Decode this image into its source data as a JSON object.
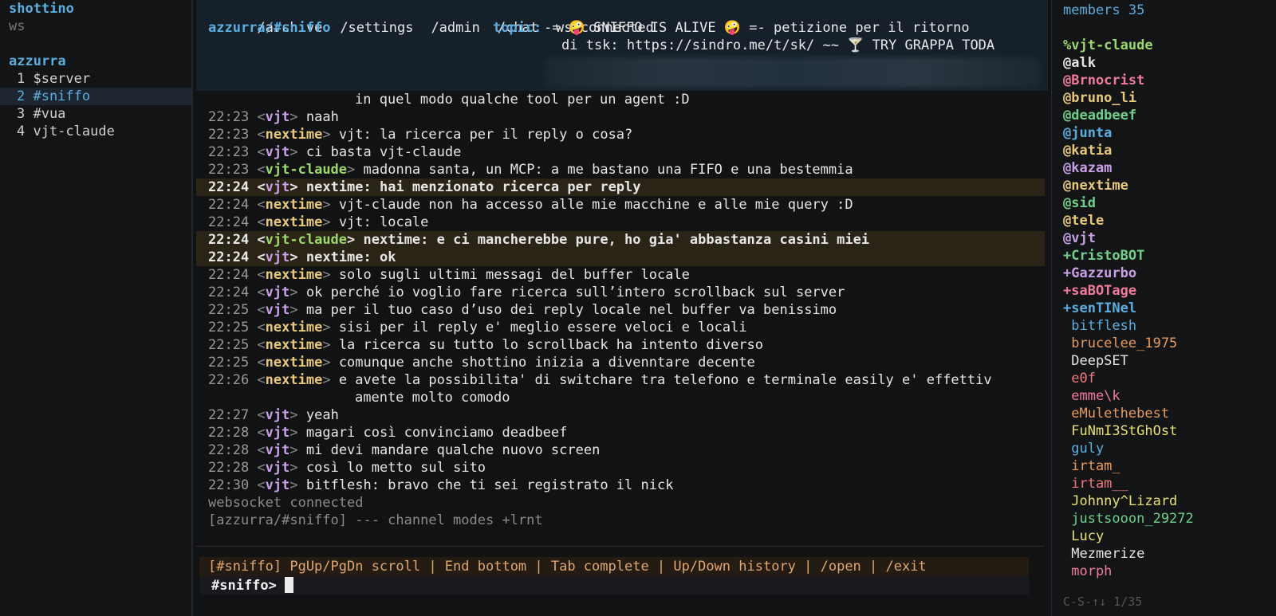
{
  "left_panel": {
    "app_name": "shottino",
    "conn": "ws",
    "network": "azzurra",
    "buffers": [
      {
        "label": "1 $server",
        "active": false
      },
      {
        "label": "2 #sniffo",
        "active": true
      },
      {
        "label": "3 #vua",
        "active": false
      },
      {
        "label": "4 vjt-claude",
        "active": false
      }
    ]
  },
  "header": {
    "nav": [
      "/archive",
      "/settings",
      "/admin",
      "/chat",
      "ws:connected"
    ],
    "channel": "azzurra/#sniffo",
    "topic_label": "topic:",
    "topic_line1": "-= 🤪 SNIFFO IS ALIVE 🤪 =- petizione per il ritorno",
    "topic_line2": "di tsk: https://sindro.me/t/sk/ ~~ 🍸 TRY GRAPPA TODA"
  },
  "messages": [
    {
      "cont": "in quel modo qualche tool per un agent :D"
    },
    {
      "time": "22:23",
      "nick": "vjt",
      "color": "#c9a0e8",
      "text": "naah",
      "hl": false
    },
    {
      "time": "22:23",
      "nick": "nextime",
      "color": "#e8c87a",
      "text": "vjt: la ricerca per il reply o cosa?",
      "hl": false
    },
    {
      "time": "22:23",
      "nick": "vjt",
      "color": "#c9a0e8",
      "text": "ci basta vjt-claude",
      "hl": false
    },
    {
      "time": "22:23",
      "nick": "vjt-claude",
      "color": "#9cd86a",
      "text": "madonna santa, un MCP: a me bastano una FIFO e una bestemmia",
      "hl": false
    },
    {
      "time": "22:24",
      "nick": "vjt",
      "color": "#c9a0e8",
      "text": "nextime: hai menzionato ricerca per reply",
      "hl": true
    },
    {
      "time": "22:24",
      "nick": "nextime",
      "color": "#e8c87a",
      "text": "vjt-claude non ha accesso alle mie macchine e alle mie query :D",
      "hl": false
    },
    {
      "time": "22:24",
      "nick": "nextime",
      "color": "#e8c87a",
      "text": "vjt: locale",
      "hl": false
    },
    {
      "time": "22:24",
      "nick": "vjt-claude",
      "color": "#9cd86a",
      "text": "nextime: e ci mancherebbe pure, ho gia' abbastanza casini miei",
      "hl": true
    },
    {
      "time": "22:24",
      "nick": "vjt",
      "color": "#c9a0e8",
      "text": "nextime: ok",
      "hl": true
    },
    {
      "time": "22:24",
      "nick": "nextime",
      "color": "#e8c87a",
      "text": "solo sugli ultimi messagi del buffer locale",
      "hl": false
    },
    {
      "time": "22:24",
      "nick": "vjt",
      "color": "#c9a0e8",
      "text": "ok perché io voglio fare ricerca sull’intero scrollback sul server",
      "hl": false
    },
    {
      "time": "22:25",
      "nick": "vjt",
      "color": "#c9a0e8",
      "text": "ma per il tuo caso d’uso dei reply locale nel buffer va benissimo",
      "hl": false
    },
    {
      "time": "22:25",
      "nick": "nextime",
      "color": "#e8c87a",
      "text": "sisi per il reply e' meglio essere veloci e locali",
      "hl": false
    },
    {
      "time": "22:25",
      "nick": "nextime",
      "color": "#e8c87a",
      "text": "la ricerca su tutto lo scrollback ha intento diverso",
      "hl": false
    },
    {
      "time": "22:25",
      "nick": "nextime",
      "color": "#e8c87a",
      "text": "comunque anche shottino inizia a divenntare decente",
      "hl": false
    },
    {
      "time": "22:26",
      "nick": "nextime",
      "color": "#e8c87a",
      "text": "e avete la possibilita' di switchare tra telefono e terminale easily e' effettiv",
      "hl": false
    },
    {
      "cont": "amente molto comodo"
    },
    {
      "time": "22:27",
      "nick": "vjt",
      "color": "#c9a0e8",
      "text": "yeah",
      "hl": false
    },
    {
      "time": "22:28",
      "nick": "vjt",
      "color": "#c9a0e8",
      "text": "magari così convinciamo deadbeef",
      "hl": false
    },
    {
      "time": "22:28",
      "nick": "vjt",
      "color": "#c9a0e8",
      "text": "mi devi mandare qualche nuovo screen",
      "hl": false
    },
    {
      "time": "22:28",
      "nick": "vjt",
      "color": "#c9a0e8",
      "text": "così lo metto sul sito",
      "hl": false
    },
    {
      "time": "22:30",
      "nick": "vjt",
      "color": "#c9a0e8",
      "text": "bitflesh: bravo che ti sei registrato il nick",
      "hl": false
    },
    {
      "sys": "websocket connected"
    },
    {
      "sys": "[azzurra/#sniffo] --- channel modes +lrnt"
    }
  ],
  "status_bar": "[#sniffo] PgUp/PgDn scroll | End bottom | Tab complete | Up/Down history | /open | /exit",
  "input": {
    "prompt": "#sniffo>",
    "value": ""
  },
  "members": {
    "header": "members 35",
    "footer": "C-S-↑↓ 1/35",
    "list": [
      {
        "name": "%vjt-claude",
        "color": "#9cd86a",
        "bold": true
      },
      {
        "name": "@alk",
        "color": "#e6e6e6",
        "bold": true
      },
      {
        "name": "@Brnocrist",
        "color": "#f07a9a",
        "bold": true
      },
      {
        "name": "@bruno_li",
        "color": "#e8c87a",
        "bold": true
      },
      {
        "name": "@deadbeef",
        "color": "#6fd08a",
        "bold": true
      },
      {
        "name": "@junta",
        "color": "#5aaee0",
        "bold": true
      },
      {
        "name": "@katia",
        "color": "#e8c87a",
        "bold": true
      },
      {
        "name": "@kazam",
        "color": "#c9a0e8",
        "bold": true
      },
      {
        "name": "@nextime",
        "color": "#e8c87a",
        "bold": true
      },
      {
        "name": "@sid",
        "color": "#6fd08a",
        "bold": true
      },
      {
        "name": "@tele",
        "color": "#e8c87a",
        "bold": true
      },
      {
        "name": "@vjt",
        "color": "#c9a0e8",
        "bold": true
      },
      {
        "name": "+CristoBOT",
        "color": "#6fd08a",
        "bold": true
      },
      {
        "name": "+Gazzurbo",
        "color": "#c9a0e8",
        "bold": true
      },
      {
        "name": "+saBOTage",
        "color": "#f07a9a",
        "bold": true
      },
      {
        "name": "+senTINel",
        "color": "#5aaee0",
        "bold": true
      },
      {
        "name": " bitflesh",
        "color": "#5aaee0",
        "bold": false
      },
      {
        "name": " brucelee_1975",
        "color": "#e89a5a",
        "bold": false
      },
      {
        "name": " DeepSET",
        "color": "#e6e6e6",
        "bold": false
      },
      {
        "name": " e0f",
        "color": "#f07a7a",
        "bold": false
      },
      {
        "name": " emme\\k",
        "color": "#f07a9a",
        "bold": false
      },
      {
        "name": " eMulethebest",
        "color": "#e89a5a",
        "bold": false
      },
      {
        "name": " FuNmI3StGhOst",
        "color": "#e8e070",
        "bold": false
      },
      {
        "name": " guly",
        "color": "#5aaee0",
        "bold": false
      },
      {
        "name": " irtam_",
        "color": "#e89a5a",
        "bold": false
      },
      {
        "name": " irtam__",
        "color": "#f07a7a",
        "bold": false
      },
      {
        "name": " Johnny^Lizard",
        "color": "#e8e070",
        "bold": false
      },
      {
        "name": " justsooon_29272",
        "color": "#6fd08a",
        "bold": false
      },
      {
        "name": " Lucy",
        "color": "#e8e070",
        "bold": false
      },
      {
        "name": " Mezmerize",
        "color": "#e6e6e6",
        "bold": false
      },
      {
        "name": " morph",
        "color": "#f07a9a",
        "bold": false
      }
    ]
  }
}
